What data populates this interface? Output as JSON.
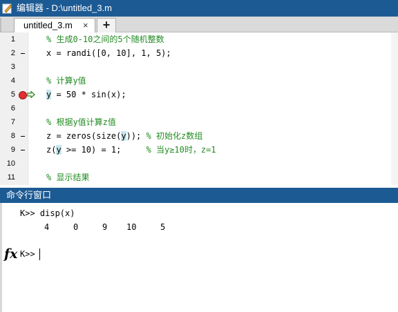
{
  "window": {
    "title": "编辑器 - D:\\untitled_3.m"
  },
  "tabs": {
    "active_label": "untitled_3.m",
    "close_glyph": "×",
    "add_glyph": "+"
  },
  "editor": {
    "lines": [
      {
        "num": "1",
        "code": "% 生成0-10之间的5个随机整数",
        "type": "comment"
      },
      {
        "num": "2",
        "code": "x = randi([0, 10], 1, 5);",
        "type": "code",
        "dash": true
      },
      {
        "num": "3",
        "code": "",
        "type": "blank"
      },
      {
        "num": "4",
        "code": "% 计算y值",
        "type": "comment"
      },
      {
        "num": "5",
        "code_y": "y",
        "code_rest": " = 50 * sin(x);",
        "type": "breakpoint"
      },
      {
        "num": "6",
        "code": "",
        "type": "blank"
      },
      {
        "num": "7",
        "code": "% 根据y值计算z值",
        "type": "comment"
      },
      {
        "num": "8",
        "code_a": "z = zeros(size(",
        "code_y": "y",
        "code_b": ")); ",
        "code_c": "% 初始化z数组",
        "type": "mixed",
        "dash": true
      },
      {
        "num": "9",
        "code_a": "z(",
        "code_y": "y",
        "code_b": " >= 10) = 1;     ",
        "code_c": "% 当y≥10时，z=1",
        "type": "mixed",
        "dash": true
      },
      {
        "num": "10",
        "code": "",
        "type": "blank"
      },
      {
        "num": "11",
        "code": "% 显示结果",
        "type": "comment"
      }
    ]
  },
  "command_window": {
    "title": "命令行窗口",
    "history_prompt": "K>> disp(x)",
    "output_values": [
      "4",
      "0",
      "9",
      "10",
      "5"
    ],
    "current_prompt": "K>>",
    "fx_label": "fx"
  },
  "colors": {
    "title_bg": "#1c5a94",
    "comment": "#228b22",
    "highlight": "#c6e6ee",
    "breakpoint": "#e03030"
  }
}
